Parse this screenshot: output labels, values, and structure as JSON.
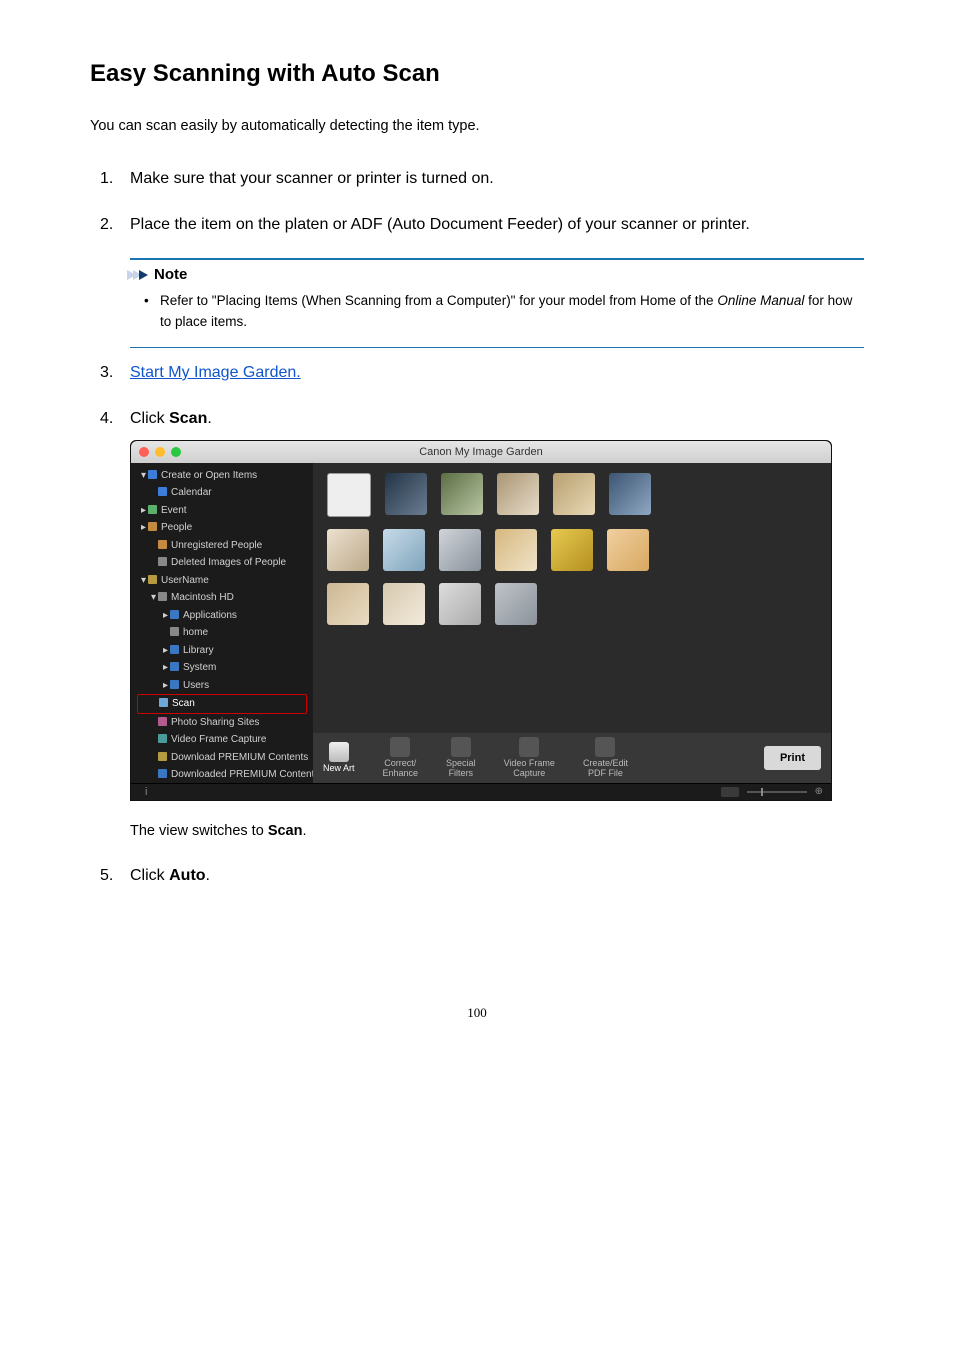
{
  "title": "Easy Scanning with Auto Scan",
  "intro": "You can scan easily by automatically detecting the item type.",
  "steps": {
    "s1": {
      "num": "1.",
      "text": "Make sure that your scanner or printer is turned on."
    },
    "s2": {
      "num": "2.",
      "text": "Place the item on the platen or ADF (Auto Document Feeder) of your scanner or printer."
    },
    "s3": {
      "num": "3.",
      "link": "Start My Image Garden."
    },
    "s4": {
      "num": "4.",
      "prefix": "Click ",
      "bold": "Scan",
      "suffix": "."
    },
    "s5": {
      "num": "5.",
      "prefix": "Click ",
      "bold": "Auto",
      "suffix": "."
    }
  },
  "note": {
    "header": "Note",
    "text_before": "Refer to \"Placing Items (When Scanning from a Computer)\" for your model from Home of the ",
    "italic": "Online Manual",
    "text_after": " for how to place items."
  },
  "view_switch": {
    "prefix": "The view switches to ",
    "bold": "Scan",
    "suffix": "."
  },
  "page_number": "100",
  "screenshot": {
    "window_title": "Canon My Image Garden",
    "sidebar": {
      "items": [
        {
          "label": "Create or Open Items",
          "arrow": "▾",
          "indent": 0,
          "icon": "si-blue"
        },
        {
          "label": "Calendar",
          "indent": 1,
          "icon": "si-blue"
        },
        {
          "label": "Event",
          "arrow": "▸",
          "indent": 0,
          "icon": "si-green"
        },
        {
          "label": "People",
          "arrow": "▸",
          "indent": 0,
          "icon": "si-person"
        },
        {
          "label": "Unregistered People",
          "indent": 1,
          "icon": "si-person"
        },
        {
          "label": "Deleted Images of People",
          "indent": 1,
          "icon": "si-grey"
        },
        {
          "label": "UserName",
          "arrow": "▾",
          "indent": 0,
          "icon": "si-yel"
        },
        {
          "label": "Macintosh HD",
          "arrow": "▾",
          "indent": 1,
          "icon": "si-grey"
        },
        {
          "label": "Applications",
          "arrow": "▸",
          "indent": 2,
          "icon": "si-folder"
        },
        {
          "label": "home",
          "indent": 2,
          "icon": "si-grey"
        },
        {
          "label": "Library",
          "arrow": "▸",
          "indent": 2,
          "icon": "si-folder"
        },
        {
          "label": "System",
          "arrow": "▸",
          "indent": 2,
          "icon": "si-folder"
        },
        {
          "label": "Users",
          "arrow": "▸",
          "indent": 2,
          "icon": "si-folder"
        },
        {
          "label": "Scan",
          "indent": 1,
          "icon": "si-scan",
          "highlight": true
        },
        {
          "label": "Photo Sharing Sites",
          "indent": 1,
          "icon": "si-pink"
        },
        {
          "label": "Video Frame Capture",
          "indent": 1,
          "icon": "si-vid"
        },
        {
          "label": "Download PREMIUM Contents",
          "indent": 1,
          "icon": "si-yel"
        },
        {
          "label": "Downloaded PREMIUM Contents",
          "indent": 1,
          "icon": "si-folder"
        }
      ]
    },
    "actions": [
      {
        "label": "New Art",
        "active": true
      },
      {
        "label": "Correct/\nEnhance",
        "active": false
      },
      {
        "label": "Special\nFilters",
        "active": false
      },
      {
        "label": "Video Frame\nCapture",
        "active": false
      },
      {
        "label": "Create/Edit\nPDF File",
        "active": false
      }
    ],
    "print_label": "Print",
    "info_label": "i"
  }
}
